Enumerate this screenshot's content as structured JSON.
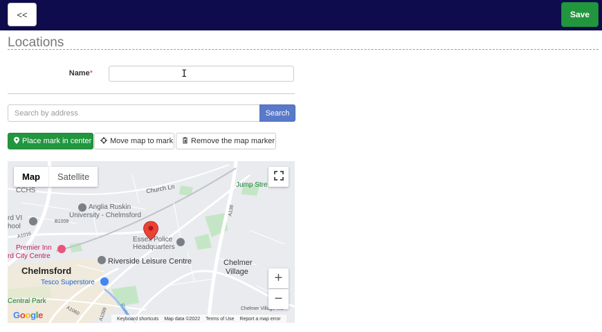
{
  "header": {
    "back_label": "<<",
    "save_label": "Save"
  },
  "page": {
    "title": "Locations"
  },
  "form": {
    "name_label": "Name",
    "required_mark": "*",
    "name_value": "",
    "cursor_glyph": "I"
  },
  "search": {
    "placeholder": "Search by address",
    "button_label": "Search"
  },
  "actions": {
    "place_mark": "Place mark in center",
    "move_map": "Move map to mark",
    "remove_marker": "Remove the map marker"
  },
  "map": {
    "type_map": "Map",
    "type_satellite": "Satellite",
    "zoom_in": "+",
    "zoom_out": "−",
    "fullscreen": "⛶",
    "logo": "Google",
    "footer": {
      "shortcuts": "Keyboard shortcuts",
      "data": "Map data ©2022",
      "terms": "Terms of Use",
      "report": "Report a map error"
    },
    "labels": {
      "cchs": "CCHS",
      "church": "Church Ln",
      "jump": "Jump Stre",
      "anglia1": "Anglia Ruskin",
      "anglia2": "University - Chelmsford",
      "b1008": "B1008",
      "school1": "rd VI",
      "school2": "hool",
      "a1016": "A1016",
      "a138": "A138",
      "essex1": "Essex Police",
      "essex2": "Headquarters",
      "premier1": "Premier Inn",
      "premier2": "rd City Centre",
      "chelmsford": "Chelmsford",
      "riverside": "Riverside Leisure Centre",
      "chelmer1": "Chelmer",
      "chelmer2": "Village",
      "tesco": "Tesco Superstore",
      "central": "Central Park",
      "river": "River",
      "a1099": "A1099",
      "a1060": "A1060",
      "chelmer_road": "Chelmer Village Wa"
    }
  },
  "colors": {
    "topbar": "#0e0c4c",
    "success": "#22963f",
    "primary": "#5a79c9",
    "marker": "#ea4335"
  }
}
